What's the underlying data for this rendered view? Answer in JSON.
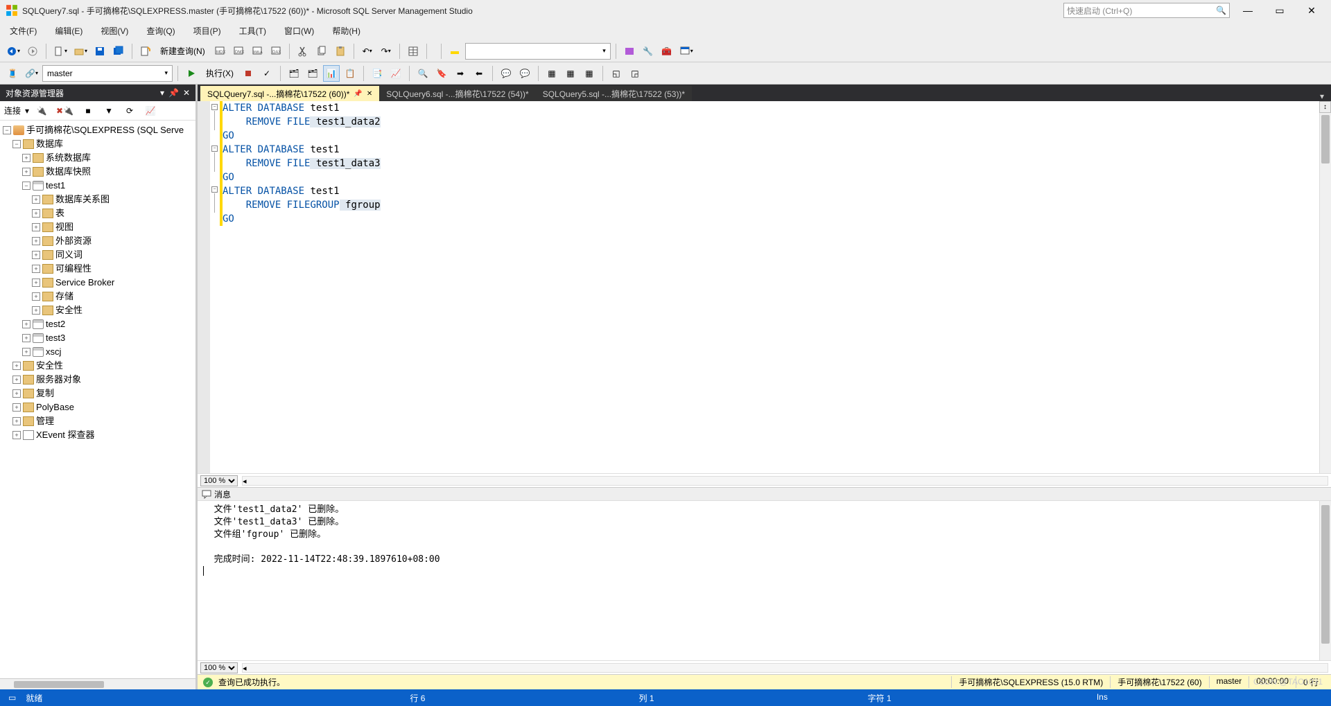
{
  "window": {
    "title": "SQLQuery7.sql - 手可摘棉花\\SQLEXPRESS.master (手可摘棉花\\17522 (60))* - Microsoft SQL Server Management Studio",
    "quicklaunch_placeholder": "快速启动 (Ctrl+Q)"
  },
  "menu": [
    "文件(F)",
    "编辑(E)",
    "视图(V)",
    "查询(Q)",
    "项目(P)",
    "工具(T)",
    "窗口(W)",
    "帮助(H)"
  ],
  "toolbar1": {
    "newquery": "新建查询(N)"
  },
  "toolbar2": {
    "dbcombo": "master",
    "execute": "执行(X)"
  },
  "explorer": {
    "title": "对象资源管理器",
    "connect": "连接",
    "root": "手可摘棉花\\SQLEXPRESS (SQL Serve",
    "db_node": "数据库",
    "sysdb": "系统数据库",
    "snapshot": "数据库快照",
    "test1": "test1",
    "test1_children": [
      "数据库关系图",
      "表",
      "视图",
      "外部资源",
      "同义词",
      "可编程性",
      "Service Broker",
      "存储",
      "安全性"
    ],
    "test2": "test2",
    "test3": "test3",
    "xscj": "xscj",
    "others": [
      "安全性",
      "服务器对象",
      "复制",
      "PolyBase",
      "管理",
      "XEvent 探查器"
    ]
  },
  "tabs": [
    {
      "label": "SQLQuery7.sql -...摘棉花\\17522 (60))*",
      "active": true,
      "pinned": true
    },
    {
      "label": "SQLQuery6.sql -...摘棉花\\17522 (54))*",
      "active": false
    },
    {
      "label": "SQLQuery5.sql -...摘棉花\\17522 (53))*",
      "active": false
    }
  ],
  "sql": {
    "l1a": "ALTER",
    "l1b": "DATABASE",
    "l1c": " test1",
    "l2a": "REMOVE",
    "l2b": "FILE",
    "l2c": " test1_data2",
    "l3": "GO",
    "l4a": "ALTER",
    "l4b": "DATABASE",
    "l4c": " test1",
    "l5a": "REMOVE",
    "l5b": "FILE",
    "l5c": " test1_data3",
    "l6": "GO",
    "l7a": "ALTER",
    "l7b": "DATABASE",
    "l7c": " test1",
    "l8a": "REMOVE",
    "l8b": "FILEGROUP",
    "l8c": " fgroup",
    "l9": "GO"
  },
  "zoom1": "100 %",
  "messages": {
    "tab": "消息",
    "l1": "文件'test1_data2' 已删除。",
    "l2": "文件'test1_data3' 已删除。",
    "l3": "文件组'fgroup' 已删除。",
    "l4": "",
    "l5": "完成时间: 2022-11-14T22:48:39.1897610+08:00"
  },
  "zoom2": "100 %",
  "exec": {
    "status": "查询已成功执行。",
    "server": "手可摘棉花\\SQLEXPRESS (15.0 RTM)",
    "user": "手可摘棉花\\17522 (60)",
    "db": "master",
    "time": "00:00:00",
    "rows": "0 行"
  },
  "status": {
    "ready": "就绪",
    "line": "行 6",
    "col": "列 1",
    "char": "字符 1",
    "ins": "Ins"
  },
  "watermark": "CSDN @TAO1031"
}
